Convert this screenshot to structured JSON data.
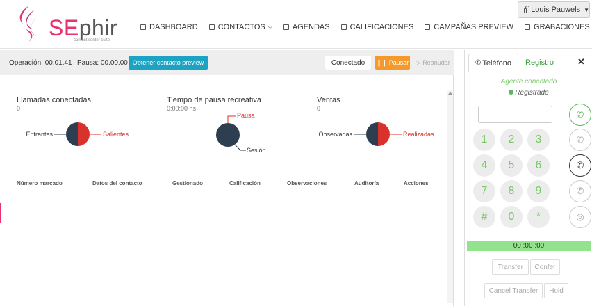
{
  "brand": {
    "name_part1": "SE",
    "name_part2": "phir",
    "tagline": "contact center suite",
    "accent": "#e5336f"
  },
  "nav": {
    "items": [
      {
        "label": "DASHBOARD",
        "icon": "dashboard-icon"
      },
      {
        "label": "CONTACTOS",
        "icon": "contacts-icon",
        "dropdown": true
      },
      {
        "label": "AGENDAS",
        "icon": "agenda-icon"
      },
      {
        "label": "CALIFICACIONES",
        "icon": "ratings-icon"
      },
      {
        "label": "CAMPAÑAS PREVIEW",
        "icon": "campaigns-icon"
      },
      {
        "label": "GRABACIONES",
        "icon": "recordings-icon"
      }
    ]
  },
  "user": {
    "name": "Louis Pauwels",
    "icon": "lock-icon"
  },
  "status": {
    "operacion": "Operación: 00.01.41",
    "pausa": "Pausa: 00.00.00",
    "preview_button": "Obtener contacto preview",
    "estado": "Conectado",
    "pausar_button": "Pausar",
    "reanudar_button": "Reanudar",
    "colors": {
      "preview": "#1ca3c4",
      "pausar": "#f59a2a"
    }
  },
  "stats": {
    "llamadas": {
      "title": "Llamadas conectadas",
      "value": "0",
      "label_left": "Entrantes",
      "label_right": "Salientes"
    },
    "pausa": {
      "title": "Tiempo de pausa recreativa",
      "value": "0:00:00 hs",
      "label_top": "Pausa",
      "label_bottom": "Sesión"
    },
    "ventas": {
      "title": "Ventas",
      "value": "0",
      "label_left": "Observadas",
      "label_right": "Realizadas"
    },
    "colors": {
      "dark": "#2c3e50",
      "red": "#d9312b"
    }
  },
  "table": {
    "headers": [
      "Número marcado",
      "Datos del contacto",
      "Gestionado",
      "Calificación",
      "Observaciones",
      "Auditoría",
      "Acciones"
    ],
    "rows": []
  },
  "phone": {
    "tab_telefono": "Teléfono",
    "tab_registro": "Registro",
    "close": "✕",
    "agent_status": "Agente conectado",
    "reg_status": "Registrado",
    "keys": [
      "1",
      "2",
      "3",
      "4",
      "5",
      "6",
      "7",
      "8",
      "9",
      "#",
      "0",
      "*"
    ],
    "timer": "00 :00 :00",
    "transfer_button": "Transfer",
    "confer_button": "Confer",
    "cancel_transfer_button": "Cancel Transfer",
    "hold_button": "Hold",
    "colors": {
      "green": "#7cc66a",
      "timer_bg": "#92e38c"
    }
  }
}
